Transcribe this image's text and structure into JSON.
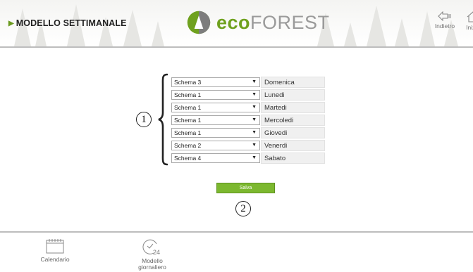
{
  "header": {
    "title": "MODELLO SETTIMANALE",
    "logo": {
      "eco": "eco",
      "forest": "FOREST"
    },
    "nav": [
      {
        "label": "Indietro",
        "icon": "back-arrow-icon"
      },
      {
        "label": "Inizio",
        "icon": "home-icon"
      }
    ]
  },
  "callouts": {
    "one": "1",
    "two": "2"
  },
  "schedule": [
    {
      "scheme": "Schema 3",
      "day": "Domenica"
    },
    {
      "scheme": "Schema 1",
      "day": "Lunedi"
    },
    {
      "scheme": "Schema 1",
      "day": "Martedi"
    },
    {
      "scheme": "Schema 1",
      "day": "Mercoledi"
    },
    {
      "scheme": "Schema 1",
      "day": "Giovedi"
    },
    {
      "scheme": "Schema 2",
      "day": "Venerdi"
    },
    {
      "scheme": "Schema 4",
      "day": "Sabato"
    }
  ],
  "save_label": "Salva",
  "footer": [
    {
      "label": "Calendario",
      "icon": "calendar-icon"
    },
    {
      "label": "Modello giornaliero",
      "icon": "clock-24-icon"
    }
  ],
  "colors": {
    "accent": "#7cb82f",
    "logo_green": "#6fa11e",
    "logo_gray": "#9a9a9a"
  }
}
